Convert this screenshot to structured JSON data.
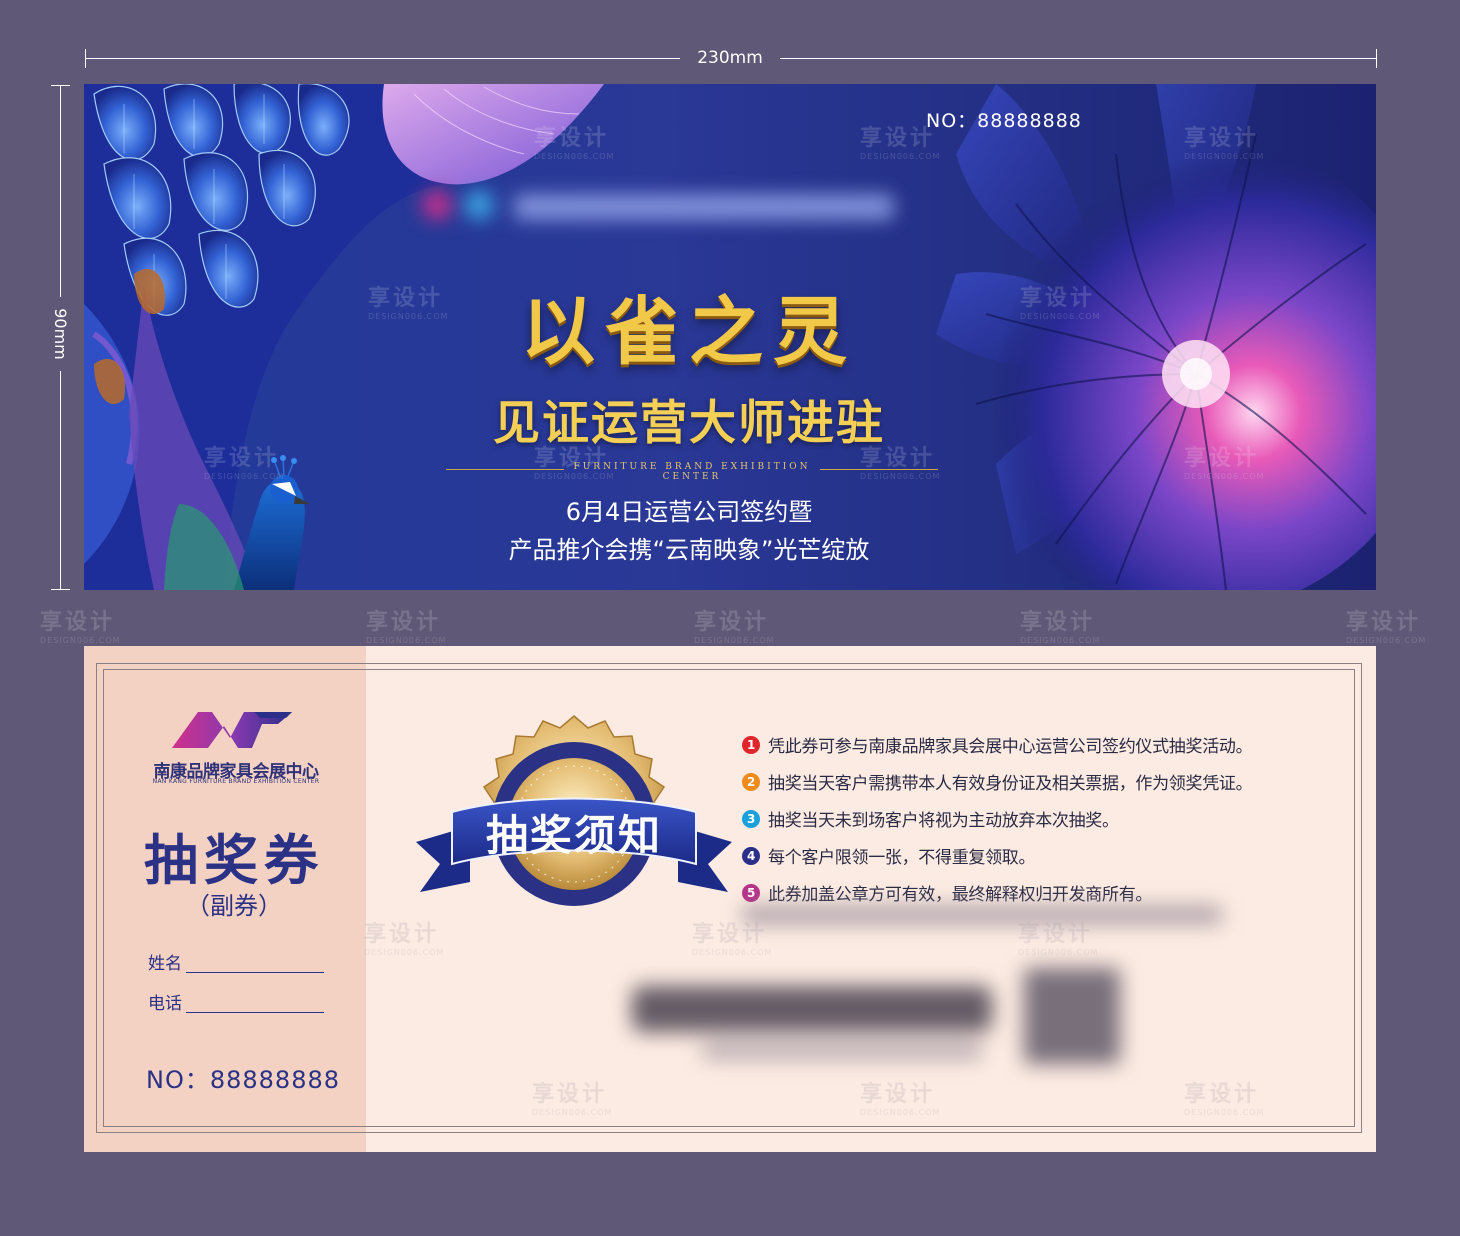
{
  "dimensions": {
    "width_label": "230mm",
    "height_label": "90mm"
  },
  "front": {
    "serial": "NO：88888888",
    "title": "以雀之灵",
    "subtitle": "见证运营大师进驻",
    "english_line": "FURNITURE BRAND EXHIBITION CENTER",
    "desc_line1": "6月4日运营公司签约暨",
    "desc_line2": "产品推介会携“云南映象”光芒绽放"
  },
  "back": {
    "logo_cn": "南康品牌家具会展中心",
    "logo_en": "NAN KANG FURNITURE BRAND EXHIBITION CENTER",
    "stub_title": "抽奖券",
    "stub_subtitle": "（副券）",
    "name_label": "姓名",
    "phone_label": "电话",
    "stub_serial": "NO：88888888",
    "badge_text": "抽奖须知",
    "rules": [
      {
        "num": "1",
        "text": "凭此券可参与南康品牌家具会展中心运营公司签约仪式抽奖活动。",
        "color": "#e0262c"
      },
      {
        "num": "2",
        "text": "抽奖当天客户需携带本人有效身份证及相关票据，作为领奖凭证。",
        "color": "#f08a1c"
      },
      {
        "num": "3",
        "text": "抽奖当天未到场客户将视为主动放弃本次抽奖。",
        "color": "#1aa0dc"
      },
      {
        "num": "4",
        "text": "每个客户限领一张，不得重复领取。",
        "color": "#2a2f8a"
      },
      {
        "num": "5",
        "text": "此券加盖公章方可有效，最终解释权归开发商所有。",
        "color": "#b8328a"
      }
    ]
  },
  "watermark": {
    "cn": "享设计",
    "en": "DESIGN006.COM"
  },
  "colors": {
    "background": "#5f5876",
    "front_blue": "#2a3896",
    "gold": "#f2c848",
    "stub_pink": "#f3d2c3",
    "ticket_bg": "#fcebe2",
    "navy_text": "#2b3185"
  }
}
